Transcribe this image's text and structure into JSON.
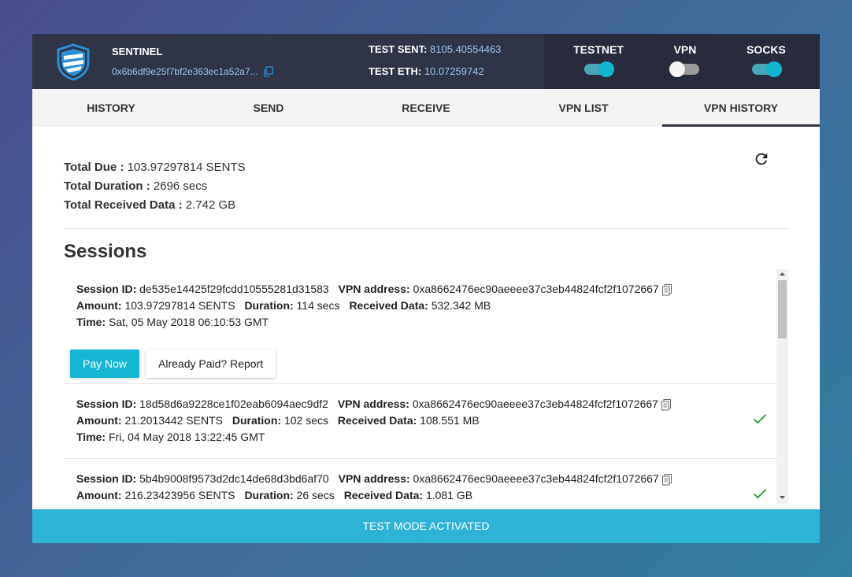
{
  "header": {
    "brand": "SENTINEL",
    "address": "0x6b6df9e25f7bf2e363ec1a52a7...",
    "test_sent_label": "TEST SENT:",
    "test_sent_value": "8105.40554463",
    "test_eth_label": "TEST ETH:",
    "test_eth_value": "10.07259742",
    "toggles": [
      {
        "label": "TESTNET",
        "state": "on"
      },
      {
        "label": "VPN",
        "state": "off"
      },
      {
        "label": "SOCKS",
        "state": "on"
      }
    ]
  },
  "tabs": [
    {
      "label": "HISTORY",
      "active": false
    },
    {
      "label": "SEND",
      "active": false
    },
    {
      "label": "RECEIVE",
      "active": false
    },
    {
      "label": "VPN LIST",
      "active": false
    },
    {
      "label": "VPN HISTORY",
      "active": true
    }
  ],
  "summary": {
    "total_due_label": "Total Due :",
    "total_due_value": "103.97297814 SENTS",
    "total_duration_label": "Total Duration :",
    "total_duration_value": "2696 secs",
    "total_received_label": "Total Received Data :",
    "total_received_value": "2.742 GB"
  },
  "sessions_title": "Sessions",
  "labels": {
    "session_id": "Session ID:",
    "vpn_address": "VPN address:",
    "amount": "Amount:",
    "duration": "Duration:",
    "received": "Received Data:",
    "time": "Time:"
  },
  "sessions": [
    {
      "id": "de535e14425f29fcdd10555281d31583",
      "vpn_address": "0xa8662476ec90aeeee37c3eb44824fcf2f1072667",
      "amount": "103.97297814 SENTS",
      "duration": "114 secs",
      "received": "532.342 MB",
      "time": "Sat, 05 May 2018 06:10:53 GMT",
      "paid": false
    },
    {
      "id": "18d58d6a9228ce1f02eab6094aec9df2",
      "vpn_address": "0xa8662476ec90aeeee37c3eb44824fcf2f1072667",
      "amount": "21.2013442 SENTS",
      "duration": "102 secs",
      "received": "108.551 MB",
      "time": "Fri, 04 May 2018 13:22:45 GMT",
      "paid": true
    },
    {
      "id": "5b4b9008f9573d2dc14de68d3bd6af70",
      "vpn_address": "0xa8662476ec90aeeee37c3eb44824fcf2f1072667",
      "amount": "216.23423956 SENTS",
      "duration": "26 secs",
      "received": "1.081 GB",
      "paid": true
    }
  ],
  "buttons": {
    "pay_now": "Pay Now",
    "already_paid": "Already Paid? Report"
  },
  "footer": "TEST MODE ACTIVATED",
  "colors": {
    "header_bg": "#2f3447",
    "accent": "#13b7d3",
    "footer_bg": "#2eb3d6",
    "check": "#1a9a2a"
  }
}
